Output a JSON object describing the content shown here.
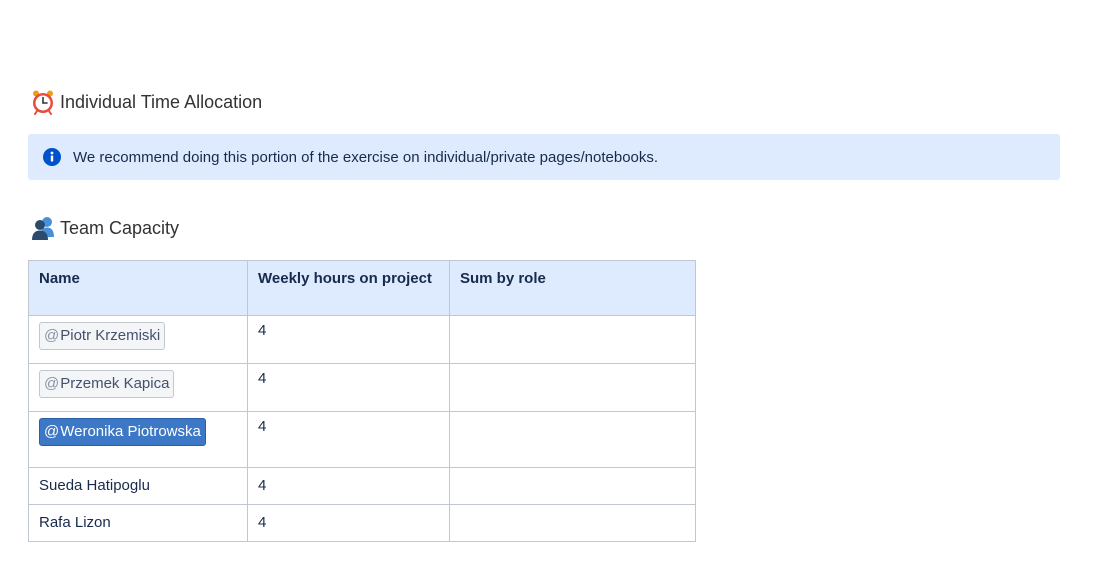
{
  "sections": {
    "time_allocation": {
      "icon": "alarm-clock-icon",
      "title": "Individual Time Allocation"
    },
    "info_panel": {
      "icon": "info-icon",
      "text": "We recommend doing this portion of the exercise on individual/private pages/notebooks."
    },
    "team_capacity": {
      "icon": "people-icon",
      "title": "Team Capacity"
    }
  },
  "table": {
    "headers": {
      "name": "Name",
      "hours": "Weekly hours on project",
      "sum": "Sum by role"
    },
    "rows": [
      {
        "name": "Piotr Krzemiski",
        "mention": true,
        "selected": false,
        "hours": "4",
        "sum": ""
      },
      {
        "name": "Przemek Kapica",
        "mention": true,
        "selected": false,
        "hours": "4",
        "sum": ""
      },
      {
        "name": "Weronika Piotrowska",
        "mention": true,
        "selected": true,
        "hours": "4",
        "sum": ""
      },
      {
        "name": "Sueda Hatipoglu",
        "mention": false,
        "selected": false,
        "hours": "4",
        "sum": ""
      },
      {
        "name": "Rafa Lizon",
        "mention": false,
        "selected": false,
        "hours": "4",
        "sum": ""
      }
    ],
    "mention_prefix": "@"
  },
  "colors": {
    "panel_bg": "#deebff",
    "header_bg": "#deebff",
    "mention_selected": "#3c78c5",
    "info_icon": "#0052cc",
    "clock_red": "#e74c3c"
  }
}
